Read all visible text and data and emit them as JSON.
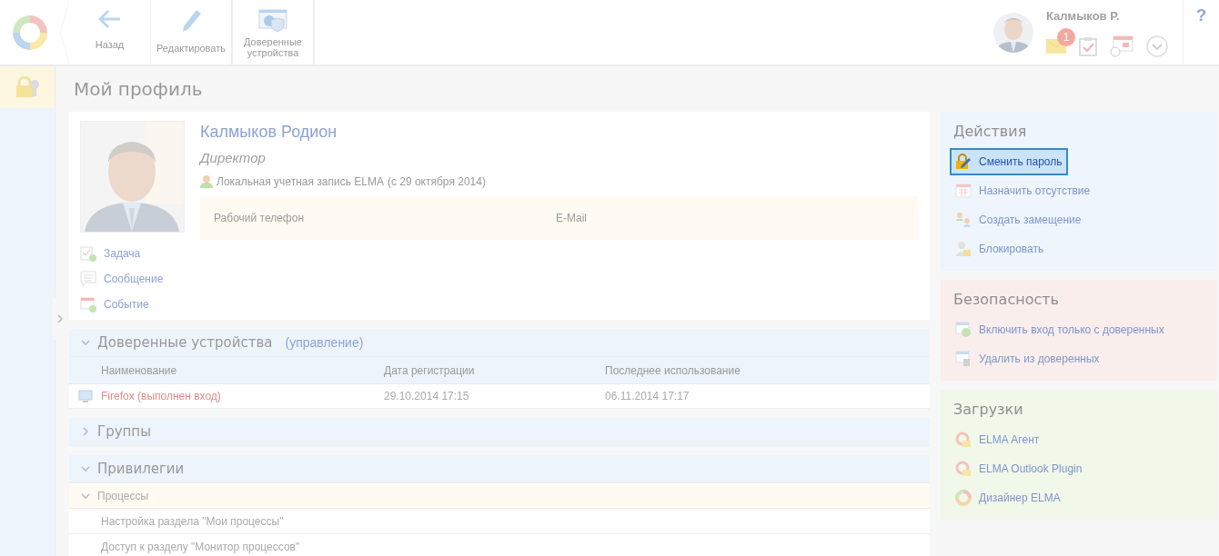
{
  "toolbar": {
    "buttons": [
      {
        "label": "Назад"
      },
      {
        "label": "Редактировать"
      },
      {
        "label": "Доверенные устройства"
      }
    ]
  },
  "user": {
    "name": "Калмыков Р.",
    "badge": "1"
  },
  "help": "?",
  "page_title": "Мой профиль",
  "profile": {
    "name": "Калмыков Родион",
    "position": "Директор",
    "account": "Локальная учетная запись ELMA",
    "since": "(с 29 октября 2014)",
    "fields": [
      "Рабочий телефон",
      "E-Mail"
    ],
    "actions": [
      "Задача",
      "Сообщение",
      "Событие"
    ]
  },
  "trusted_devices": {
    "title": "Доверенные устройства",
    "link": "(управление)",
    "expanded": true,
    "columns": [
      "Наименование",
      "Дата регистрации",
      "Последнее использование"
    ],
    "rows": [
      {
        "name": "Firefox (выполнен вход)",
        "registered": "29.10.2014 17:15",
        "last_used": "06.11.2014 17:17"
      }
    ]
  },
  "groups": {
    "title": "Группы",
    "expanded": false
  },
  "privileges": {
    "title": "Привилегии",
    "expanded": true,
    "categories": [
      {
        "name": "Процессы",
        "expanded": true,
        "items": [
          "Настройка раздела \"Мои процессы\"",
          "Доступ к разделу \"Монитор процессов\""
        ]
      }
    ]
  },
  "panels": [
    {
      "title": "Действия",
      "color": "#eef5fc",
      "items": [
        {
          "label": "Сменить пароль",
          "highlighted": true
        },
        {
          "label": "Назначить отсутствие",
          "highlighted": false
        },
        {
          "label": "Создать замещение",
          "highlighted": false
        },
        {
          "label": "Блокировать",
          "highlighted": false
        }
      ]
    },
    {
      "title": "Безопасность",
      "color": "#faeeed",
      "items": [
        {
          "label": "Включить вход только с доверенных",
          "highlighted": false
        },
        {
          "label": "Удалить из доверенных",
          "highlighted": false
        }
      ]
    },
    {
      "title": "Загрузки",
      "color": "#f1f7e9",
      "items": [
        {
          "label": "ELMA Агент",
          "highlighted": false
        },
        {
          "label": "ELMA Outlook Plugin",
          "highlighted": false
        },
        {
          "label": "Дизайнер ELMA",
          "highlighted": false
        }
      ]
    }
  ]
}
